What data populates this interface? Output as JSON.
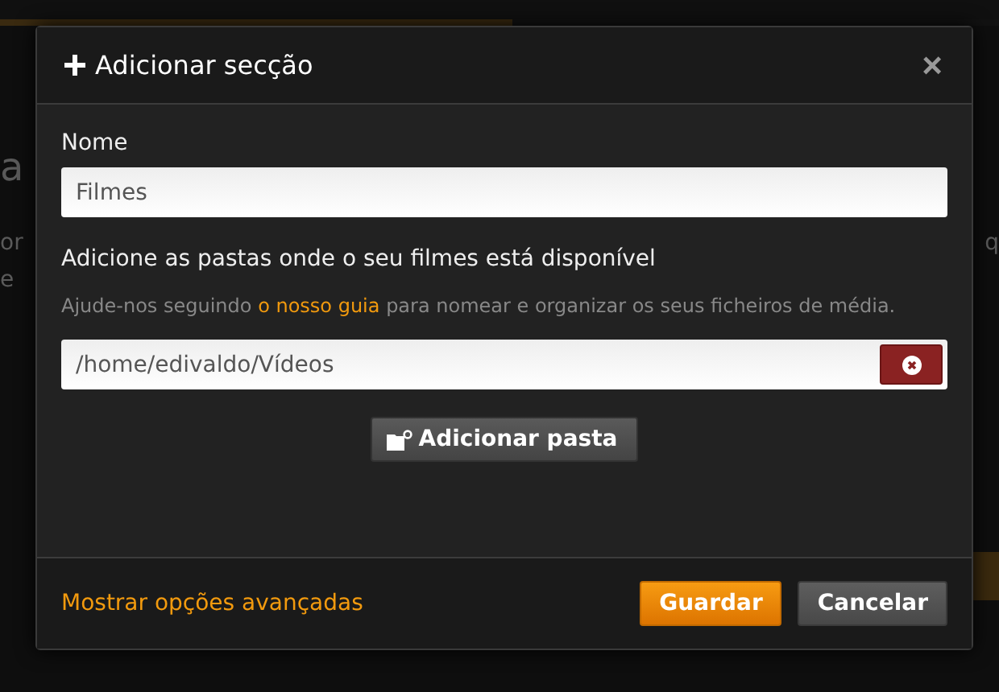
{
  "background": {
    "left_fragments": [
      "a",
      "or",
      "e"
    ],
    "right_fragments": [
      "q"
    ]
  },
  "dialog": {
    "title": "Adicionar secção",
    "close": "×",
    "name_label": "Nome",
    "name_value": "Filmes",
    "folders_heading": "Adicione as pastas onde o seu filmes está disponível",
    "help_before": "Ajude-nos seguindo ",
    "help_link": "o nosso guia",
    "help_after": " para nomear e organizar os seus ficheiros de média.",
    "folders": [
      "/home/edivaldo/Vídeos"
    ],
    "add_folder": "Adicionar pasta",
    "advanced_link": "Mostrar opções avançadas",
    "buttons": [
      {
        "label": "Guardar",
        "kind": "primary"
      },
      {
        "label": "Cancelar",
        "kind": "secondary"
      }
    ]
  }
}
